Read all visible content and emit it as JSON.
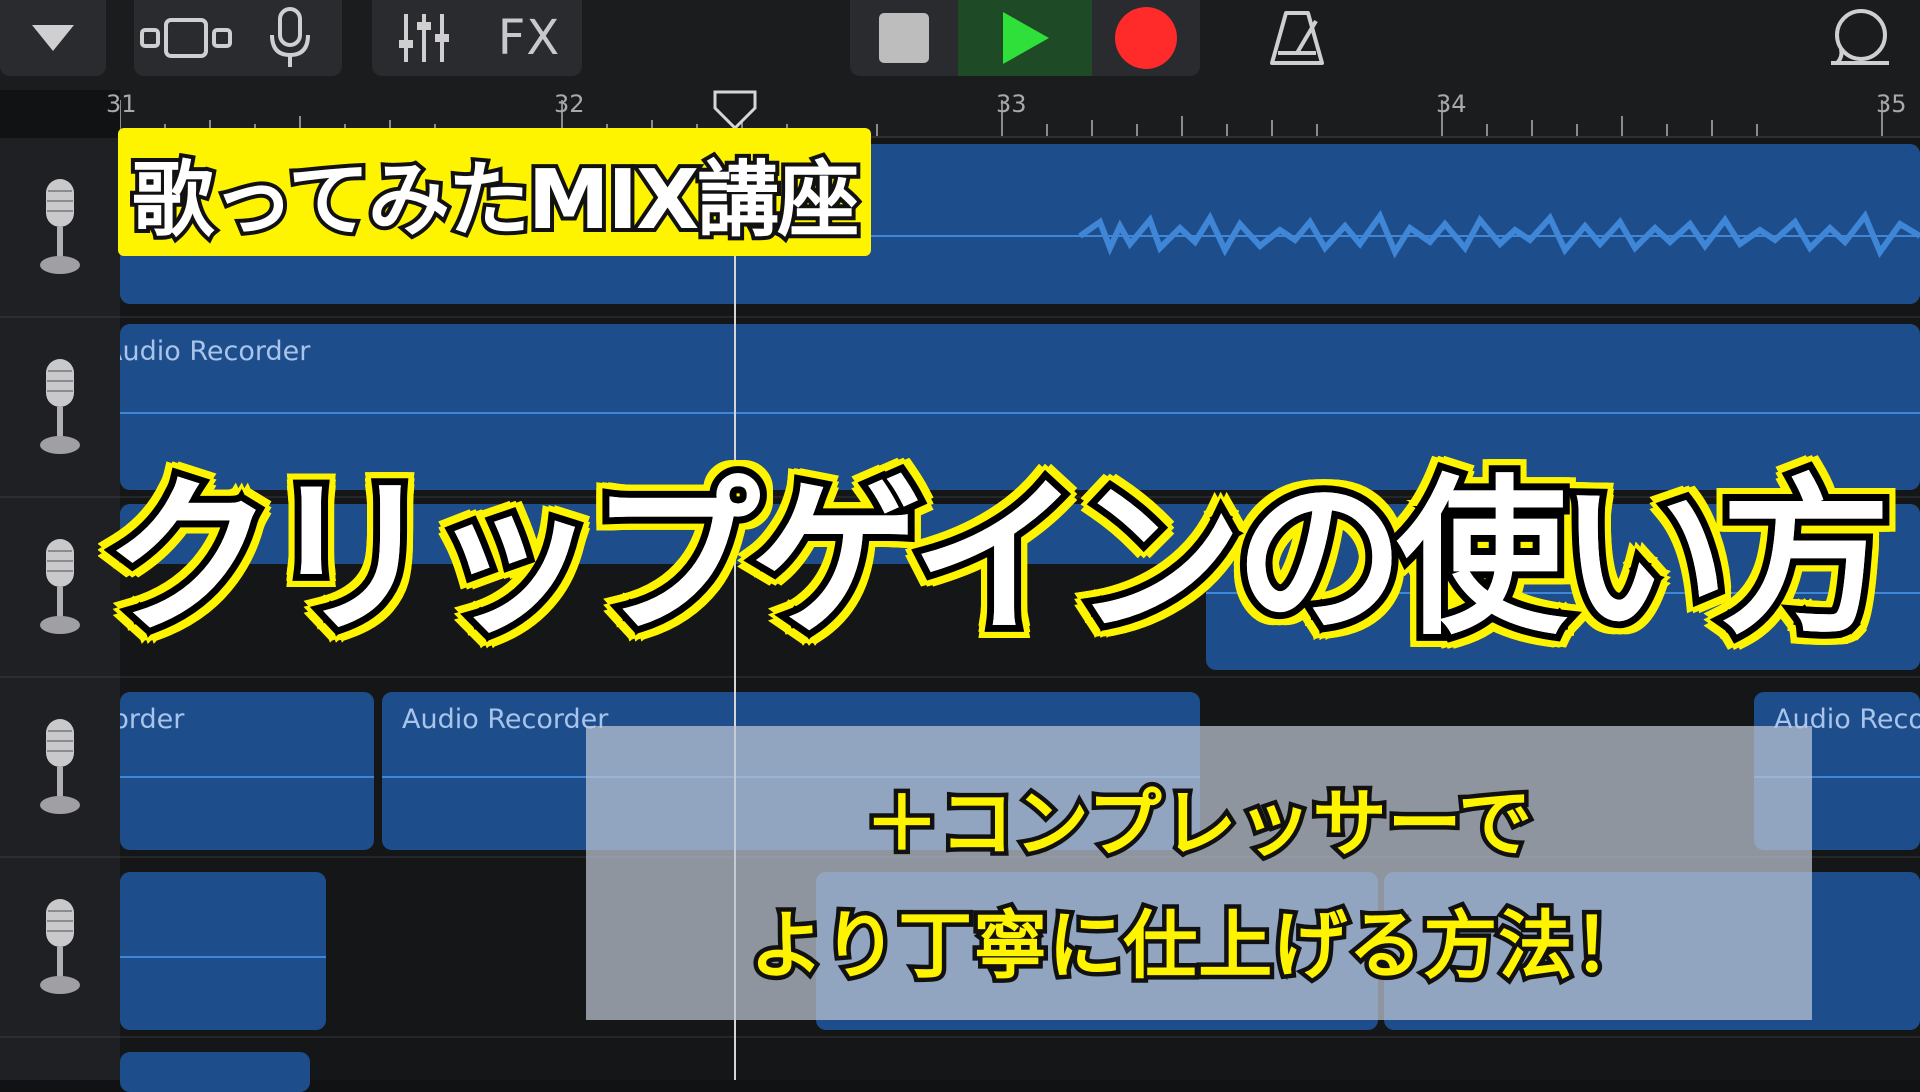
{
  "toolbar": {
    "fx_label": "FX",
    "icons": [
      "chevron-down-icon",
      "browser-view-icon",
      "microphone-icon",
      "mixer-icon",
      "fx-icon",
      "stop-icon",
      "play-icon",
      "record-icon",
      "metronome-icon",
      "loop-icon"
    ],
    "colors": {
      "play_bg": "#1f4a26",
      "play": "#2fe03a",
      "record": "#ff2a2a",
      "stop": "#bdbdbd"
    }
  },
  "ruler": {
    "bars": [
      "31",
      "32",
      "33",
      "34",
      "35"
    ]
  },
  "regions": {
    "track2": "Audio Recorder",
    "track4a": "Audio Recorder",
    "track4b": "Audio Recorder",
    "track4c": "Audio Recorder"
  },
  "overlay": {
    "badge": "歌ってみたMIX講座",
    "title": "クリップゲインの使い方",
    "subtitle_line1": "＋コンプレッサーで",
    "subtitle_line2": "より丁寧に仕上げる方法！"
  },
  "colors": {
    "region": "#1e4d8c",
    "accent_yellow": "#fff400",
    "waveform": "#3f86d6"
  }
}
